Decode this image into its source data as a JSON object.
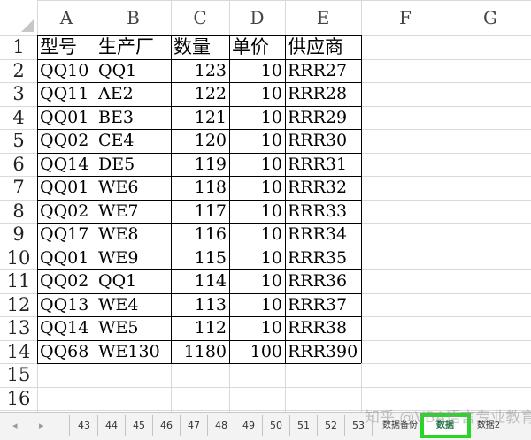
{
  "columns": [
    "A",
    "B",
    "C",
    "D",
    "E",
    "F",
    "G"
  ],
  "rows": [
    "1",
    "2",
    "3",
    "4",
    "5",
    "6",
    "7",
    "8",
    "9",
    "10",
    "11",
    "12",
    "13",
    "14",
    "15",
    "16"
  ],
  "table": {
    "headers": [
      "型号",
      "生产厂",
      "数量",
      "单价",
      "供应商"
    ],
    "data": [
      [
        "QQ10",
        "QQ1",
        "123",
        "10",
        "RRR27"
      ],
      [
        "QQ11",
        "AE2",
        "122",
        "10",
        "RRR28"
      ],
      [
        "QQ01",
        "BE3",
        "121",
        "10",
        "RRR29"
      ],
      [
        "QQ02",
        "CE4",
        "120",
        "10",
        "RRR30"
      ],
      [
        "QQ14",
        "DE5",
        "119",
        "10",
        "RRR31"
      ],
      [
        "QQ01",
        "WE6",
        "118",
        "10",
        "RRR32"
      ],
      [
        "QQ02",
        "WE7",
        "117",
        "10",
        "RRR33"
      ],
      [
        "QQ17",
        "WE8",
        "116",
        "10",
        "RRR34"
      ],
      [
        "QQ01",
        "WE9",
        "115",
        "10",
        "RRR35"
      ],
      [
        "QQ02",
        "QQ1",
        "114",
        "10",
        "RRR36"
      ],
      [
        "QQ13",
        "WE4",
        "113",
        "10",
        "RRR37"
      ],
      [
        "QQ14",
        "WE5",
        "112",
        "10",
        "RRR38"
      ],
      [
        "QQ68",
        "WE130",
        "1180",
        "100",
        "RRR390"
      ]
    ]
  },
  "tabs": {
    "nav_prev": "◂",
    "nav_next": "▸",
    "numbered": [
      "43",
      "44",
      "45",
      "46",
      "47",
      "48",
      "49",
      "50",
      "51",
      "52",
      "53"
    ],
    "backup": "数据备份",
    "active": "数据",
    "data2": "数据2"
  },
  "watermark": "知乎 @VBA语言专业教育",
  "colors": {
    "active_tab_outline": "#27d627",
    "active_tab_text": "#1e7145"
  }
}
